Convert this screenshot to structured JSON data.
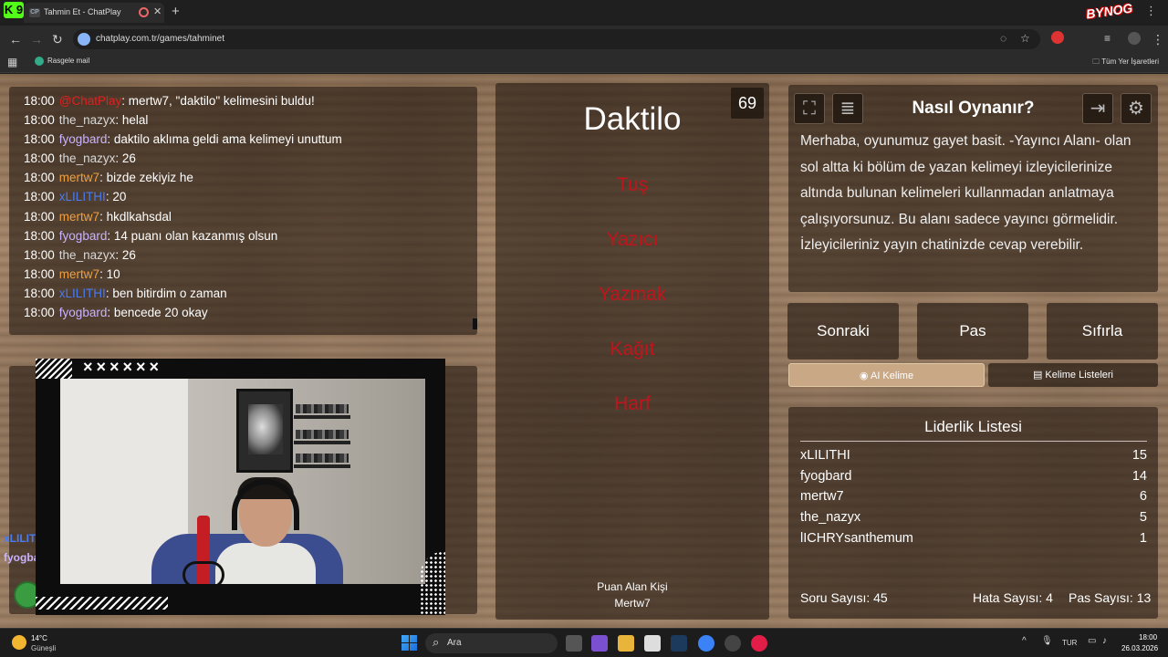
{
  "browser": {
    "app_badge": "K 9",
    "tab": {
      "favicon": "CP",
      "title": "Tahmin Et - ChatPlay"
    },
    "url": "chatplay.com.tr/games/tahminet",
    "bookmark": "Rasgele mail",
    "bookmarks_right": "Tüm Yer İşaretleri",
    "overlay_logo": "BYNOG"
  },
  "chat": {
    "lines": [
      {
        "time": "18:00",
        "user": "@ChatPlay",
        "text": ": mertw7, \"daktilo\" kelimesini buldu!",
        "color": "red"
      },
      {
        "time": "18:00",
        "user": "the_nazyx",
        "text": ": helal",
        "color": "gray"
      },
      {
        "time": "18:00",
        "user": "fyogbard",
        "text": ": daktilo aklıma geldi ama kelimeyi unuttum",
        "color": "lilac"
      },
      {
        "time": "18:00",
        "user": "the_nazyx",
        "text": ": 26",
        "color": "gray"
      },
      {
        "time": "18:00",
        "user": "mertw7",
        "text": ": bizde zekiyiz he",
        "color": "orange"
      },
      {
        "time": "18:00",
        "user": "xLILITHI",
        "text": ": 20",
        "color": "blue"
      },
      {
        "time": "18:00",
        "user": "mertw7",
        "text": ": hkdlkahsdal",
        "color": "orange"
      },
      {
        "time": "18:00",
        "user": "fyogbard",
        "text": ": 14 puanı olan kazanmış olsun",
        "color": "lilac"
      },
      {
        "time": "18:00",
        "user": "the_nazyx",
        "text": ": 26",
        "color": "gray"
      },
      {
        "time": "18:00",
        "user": "mertw7",
        "text": ": 10",
        "color": "orange"
      },
      {
        "time": "18:00",
        "user": "xLILITHI",
        "text": ": ben bitirdim o zaman",
        "color": "blue"
      },
      {
        "time": "18:00",
        "user": "fyogbard",
        "text": ": bencede 20 okay",
        "color": "lilac"
      }
    ],
    "side_fragments": [
      "xLILIT",
      "fyogba"
    ]
  },
  "webcam": {
    "marks": "××××××"
  },
  "game": {
    "remaining": "69",
    "word": "Daktilo",
    "forbidden": [
      "Tuş",
      "Yazıcı",
      "Yazmak",
      "Kağıt",
      "Harf"
    ],
    "scorer_label": "Puan Alan Kişi",
    "scorer_name": "Mertw7"
  },
  "howto": {
    "title": "Nasıl Oynanır?",
    "text": "Merhaba, oyunumuz gayet basit. -Yayıncı Alanı- olan sol altta ki bölüm de yazan kelimeyi izleyicilerinize altında bulunan kelimeleri kullanmadan anlatmaya çalışıyorsunuz. Bu alanı sadece yayıncı görmelidir. İzleyicileriniz yayın chatinizde cevap verebilir."
  },
  "controls": {
    "next": "Sonraki",
    "pass": "Pas",
    "reset": "Sıfırla"
  },
  "tabs": {
    "ai": "AI Kelime",
    "lists": "Kelime Listeleri"
  },
  "leaderboard": {
    "title": "Liderlik Listesi",
    "rows": [
      {
        "name": "xLILITHI",
        "score": "15"
      },
      {
        "name": "fyogbard",
        "score": "14"
      },
      {
        "name": "mertw7",
        "score": "6"
      },
      {
        "name": "the_nazyx",
        "score": "5"
      },
      {
        "name": "lICHRYsanthemum",
        "score": "1"
      }
    ]
  },
  "stats": {
    "questions": "Soru Sayısı: 45",
    "errors": "Hata Sayısı: 4",
    "passes": "Pas Sayısı: 13"
  },
  "taskbar": {
    "temp": "14°C",
    "weather": "Güneşli",
    "search_placeholder": "Ara",
    "lang": "TUR",
    "time": "18:00",
    "date": "26.03.2026"
  },
  "colors": {
    "forbidden": "#c3141b",
    "user_red": "#e02020",
    "user_lilac": "#c9b3ff",
    "user_orange": "#f0a040",
    "user_blue": "#4a7bf0",
    "ai_tab": "#c9a886"
  }
}
